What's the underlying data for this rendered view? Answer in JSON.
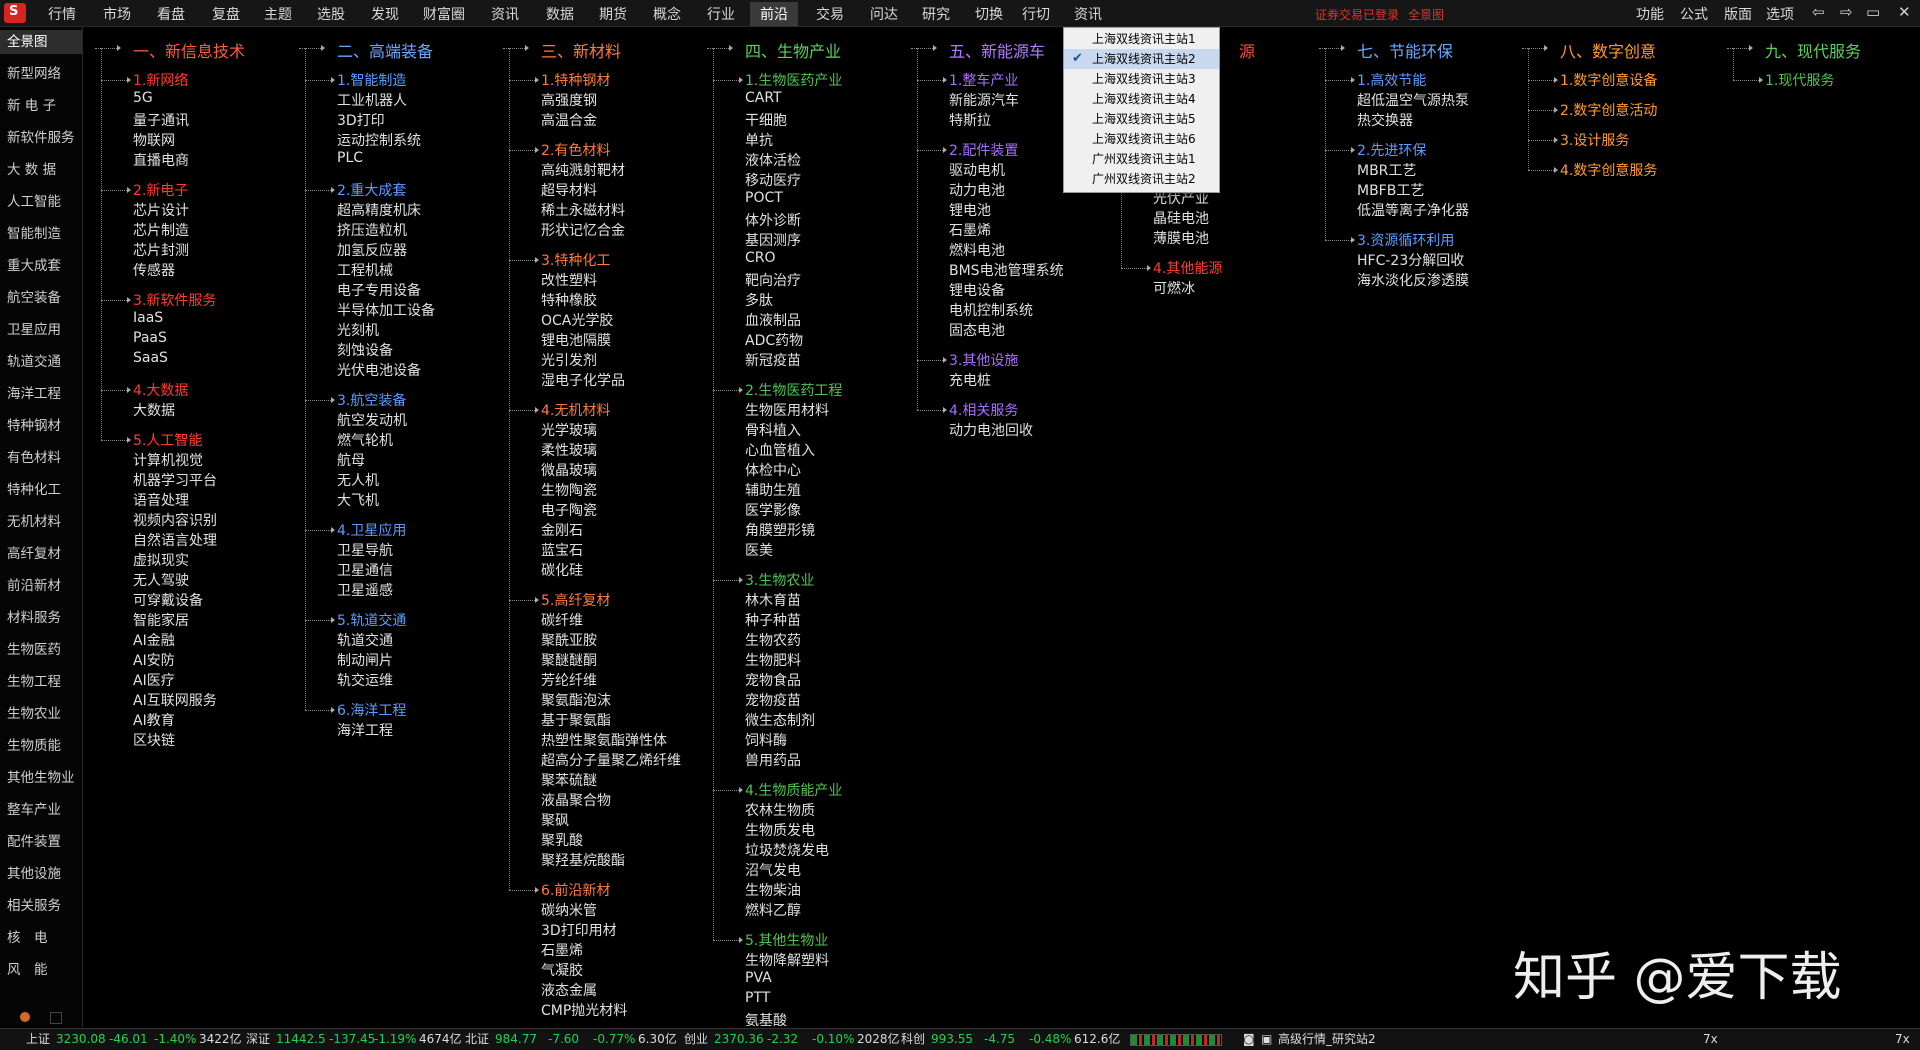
{
  "top_menu": [
    "行情",
    "市场",
    "看盘",
    "复盘",
    "主题",
    "选股",
    "发现",
    "财富圈",
    "资讯",
    "数据",
    "期货",
    "概念",
    "行业",
    "前沿",
    "交易",
    "问达",
    "研究",
    "切换",
    "行切",
    "资讯"
  ],
  "top_active": "前沿",
  "logo_text": "S",
  "login_status": "证券交易已登录",
  "view_name": "全景图",
  "right_menu": [
    "功能",
    "公式",
    "版面",
    "选项"
  ],
  "window_icons": [
    "back-arrow-icon",
    "forward-arrow-icon",
    "restore-icon",
    "minimize-icon",
    "maximize-icon",
    "close-icon"
  ],
  "sidebar": [
    "全景图",
    "新型网络",
    "新 电 子",
    "新软件服务",
    "大 数 据",
    "人工智能",
    "智能制造",
    "重大成套",
    "航空装备",
    "卫星应用",
    "轨道交通",
    "海洋工程",
    "特种钢材",
    "有色材料",
    "特种化工",
    "无机材料",
    "高纤复材",
    "前沿新材",
    "材料服务",
    "生物医药",
    "生物工程",
    "生物农业",
    "生物质能",
    "其他生物业",
    "整车产业",
    "配件装置",
    "其他设施",
    "相关服务",
    "核　电",
    "风　能"
  ],
  "sidebar_active": "全景图",
  "columns": [
    {
      "title": "一、新信息技术",
      "color": "#ff5a3c",
      "groups": [
        {
          "name": "1.新网络",
          "color": "#ff3b30",
          "items": [
            "5G",
            "量子通讯",
            "物联网",
            "直播电商"
          ]
        },
        {
          "name": "2.新电子",
          "color": "#ff3b30",
          "items": [
            "芯片设计",
            "芯片制造",
            "芯片封测",
            "传感器"
          ]
        },
        {
          "name": "3.新软件服务",
          "color": "#ff3b30",
          "items": [
            "IaaS",
            "PaaS",
            "SaaS"
          ]
        },
        {
          "name": "4.大数据",
          "color": "#ff3b30",
          "items": [
            "大数据"
          ]
        },
        {
          "name": "5.人工智能",
          "color": "#ff3b30",
          "items": [
            "计算机视觉",
            "机器学习平台",
            "语音处理",
            "视频内容识别",
            "自然语言处理",
            "虚拟现实",
            "无人驾驶",
            "可穿戴设备",
            "智能家居",
            "AI金融",
            "AI安防",
            "AI医疗",
            "AI互联网服务",
            "AI教育",
            "区块链"
          ]
        }
      ]
    },
    {
      "title": "二、高端装备",
      "color": "#6aa8ff",
      "groups": [
        {
          "name": "1.智能制造",
          "color": "#5b9cff",
          "items": [
            "工业机器人",
            "3D打印",
            "运动控制系统",
            "PLC"
          ]
        },
        {
          "name": "2.重大成套",
          "color": "#5b9cff",
          "items": [
            "超高精度机床",
            "挤压造粒机",
            "加氢反应器",
            "工程机械",
            "电子专用设备",
            "半导体加工设备",
            "光刻机",
            "刻蚀设备",
            "光伏电池设备"
          ]
        },
        {
          "name": "3.航空装备",
          "color": "#5b9cff",
          "items": [
            "航空发动机",
            "燃气轮机",
            "航母",
            "无人机",
            "大飞机"
          ]
        },
        {
          "name": "4.卫星应用",
          "color": "#5b9cff",
          "items": [
            "卫星导航",
            "卫星通信",
            "卫星遥感"
          ]
        },
        {
          "name": "5.轨道交通",
          "color": "#5b9cff",
          "items": [
            "轨道交通",
            "制动闸片",
            "轨交运维"
          ]
        },
        {
          "name": "6.海洋工程",
          "color": "#5b9cff",
          "items": [
            "海洋工程"
          ]
        }
      ]
    },
    {
      "title": "三、新材料",
      "color": "#ff7a3a",
      "groups": [
        {
          "name": "1.特种钢材",
          "color": "#ff7a3a",
          "items": [
            "高强度钢",
            "高温合金"
          ]
        },
        {
          "name": "2.有色材料",
          "color": "#ff7a3a",
          "items": [
            "高纯溅射靶材",
            "超导材料",
            "稀土永磁材料",
            "形状记忆合金"
          ]
        },
        {
          "name": "3.特种化工",
          "color": "#ff7a3a",
          "items": [
            "改性塑料",
            "特种橡胶",
            "OCA光学胶",
            "锂电池隔膜",
            "光引发剂",
            "湿电子化学品"
          ]
        },
        {
          "name": "4.无机材料",
          "color": "#ff7a3a",
          "items": [
            "光学玻璃",
            "柔性玻璃",
            "微晶玻璃",
            "生物陶瓷",
            "电子陶瓷",
            "金刚石",
            "蓝宝石",
            "碳化硅"
          ]
        },
        {
          "name": "5.高纤复材",
          "color": "#ff7a3a",
          "items": [
            "碳纤维",
            "聚酰亚胺",
            "聚醚醚酮",
            "芳纶纤维",
            "聚氨酯泡沫",
            "基于聚氨酯",
            "热塑性聚氨酯弹性体",
            "超高分子量聚乙烯纤维",
            "聚苯硫醚",
            "液晶聚合物",
            "聚砜",
            "聚乳酸",
            "聚羟基烷酸酯"
          ]
        },
        {
          "name": "6.前沿新材",
          "color": "#ff7a3a",
          "items": [
            "碳纳米管",
            "3D打印用材",
            "石墨烯",
            "气凝胶",
            "液态金属",
            "CMP抛光材料"
          ]
        }
      ]
    },
    {
      "title": "四、生物产业",
      "color": "#5ccf5c",
      "groups": [
        {
          "name": "1.生物医药产业",
          "color": "#4fc24f",
          "items": [
            "CART",
            "干细胞",
            "单抗",
            "液体活检",
            "移动医疗",
            "POCT",
            "体外诊断",
            "基因测序",
            "CRO",
            "靶向治疗",
            "多肽",
            "血液制品",
            "ADC药物",
            "新冠疫苗"
          ]
        },
        {
          "name": "2.生物医药工程",
          "color": "#4fc24f",
          "items": [
            "生物医用材料",
            "骨科植入",
            "心血管植入",
            "体检中心",
            "辅助生殖",
            "医学影像",
            "角膜塑形镜",
            "医美"
          ]
        },
        {
          "name": "3.生物农业",
          "color": "#4fc24f",
          "items": [
            "林木育苗",
            "种子种苗",
            "生物农药",
            "生物肥料",
            "宠物食品",
            "宠物疫苗",
            "微生态制剂",
            "饲料酶",
            "兽用药品"
          ]
        },
        {
          "name": "4.生物质能产业",
          "color": "#4fc24f",
          "items": [
            "农林生物质",
            "生物质发电",
            "垃圾焚烧发电",
            "沼气发电",
            "生物柴油",
            "燃料乙醇"
          ]
        },
        {
          "name": "5.其他生物业",
          "color": "#4fc24f",
          "items": [
            "生物降解塑料",
            "PVA",
            "PTT",
            "氨基酸"
          ]
        }
      ]
    },
    {
      "title": "五、新能源车",
      "color": "#b27cff",
      "groups": [
        {
          "name": "1.整车产业",
          "color": "#a86cff",
          "items": [
            "新能源汽车",
            "特斯拉"
          ]
        },
        {
          "name": "2.配件装置",
          "color": "#a86cff",
          "items": [
            "驱动电机",
            "动力电池",
            "锂电池",
            "石墨烯",
            "燃料电池",
            "BMS电池管理系统",
            "锂电设备",
            "电机控制系统",
            "固态电池"
          ]
        },
        {
          "name": "3.其他设施",
          "color": "#a86cff",
          "items": [
            "充电桩"
          ]
        },
        {
          "name": "4.相关服务",
          "color": "#a86cff",
          "items": [
            "动力电池回收"
          ]
        }
      ]
    },
    {
      "title": "源",
      "color": "#ff4a3c",
      "groups": [
        {
          "name": "",
          "color": "#ff4a3c",
          "items": [
            "光伏产业",
            "晶硅电池",
            "薄膜电池"
          ]
        },
        {
          "name": "4.其他能源",
          "color": "#ff3b30",
          "items": [
            "可燃冰"
          ]
        }
      ]
    },
    {
      "title": "七、节能环保",
      "color": "#6aa8ff",
      "groups": [
        {
          "name": "1.高效节能",
          "color": "#5b9cff",
          "items": [
            "超低温空气源热泵",
            "热交换器"
          ]
        },
        {
          "name": "2.先进环保",
          "color": "#5b9cff",
          "items": [
            "MBR工艺",
            "MBFB工艺",
            "低温等离子净化器"
          ]
        },
        {
          "name": "3.资源循环利用",
          "color": "#5b9cff",
          "items": [
            "HFC-23分解回收",
            "海水淡化反渗透膜"
          ]
        }
      ]
    },
    {
      "title": "八、数字创意",
      "color": "#ff9a30",
      "groups": [
        {
          "name": "1.数字创意设备",
          "color": "#ff9a30",
          "items": []
        },
        {
          "name": "2.数字创意活动",
          "color": "#ff9a30",
          "items": []
        },
        {
          "name": "3.设计服务",
          "color": "#ff9a30",
          "items": []
        },
        {
          "name": "4.数字创意服务",
          "color": "#ff9a30",
          "items": []
        }
      ]
    },
    {
      "title": "九、现代服务",
      "color": "#5ccf5c",
      "groups": [
        {
          "name": "1.现代服务",
          "color": "#4fc24f",
          "items": []
        }
      ]
    }
  ],
  "dropdown": {
    "items": [
      "上海双线资讯主站1",
      "上海双线资讯主站2",
      "上海双线资讯主站3",
      "上海双线资讯主站4",
      "上海双线资讯主站5",
      "上海双线资讯主站6",
      "广州双线资讯主站1",
      "广州双线资讯主站2"
    ],
    "checked_index": 1,
    "check_mark": "✔"
  },
  "status": [
    {
      "label": "上证",
      "value": "3230.08",
      "change": "-46.01",
      "pct": "-1.40%",
      "amount": "3422亿"
    },
    {
      "label": "深证",
      "value": "11442.5",
      "change": "-137.45",
      "pct": "-1.19%",
      "amount": "4674亿"
    },
    {
      "label": "北证",
      "value": "984.77",
      "change": "-7.60",
      "pct": "-0.77%",
      "amount": "6.30亿"
    },
    {
      "label": "创业",
      "value": "2370.36",
      "change": "-2.32",
      "pct": "-0.10%",
      "amount": "2028亿"
    },
    {
      "label": "科创",
      "value": "993.55",
      "change": "-4.75",
      "pct": "-0.48%",
      "amount": "612.6亿"
    }
  ],
  "status_site": "高级行情_研究站2",
  "status_right": [
    "7x",
    "7x"
  ],
  "watermark": "知乎 @爱下载"
}
